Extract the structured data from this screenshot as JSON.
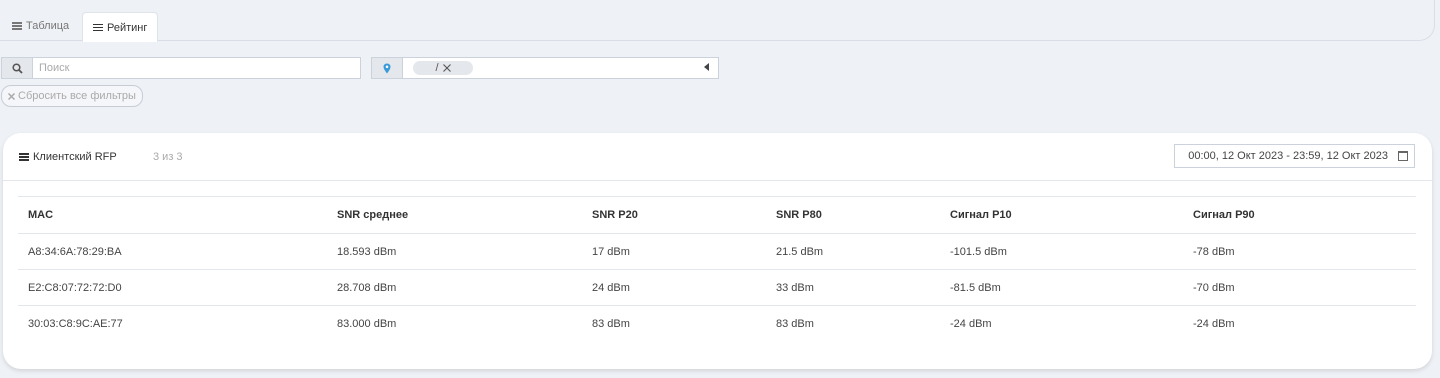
{
  "tabs": [
    {
      "label": "Таблица",
      "active": false
    },
    {
      "label": "Рейтинг",
      "active": true
    }
  ],
  "filters": {
    "search_placeholder": "Поиск",
    "location_chip": "/",
    "reset_label": "Сбросить все фильтры"
  },
  "card": {
    "title": "Клиентский RFP",
    "count": "3 из 3",
    "date_range": "00:00, 12 Окт 2023 - 23:59, 12 Окт 2023"
  },
  "table": {
    "headers": [
      "MAC",
      "SNR среднее",
      "SNR P20",
      "SNR P80",
      "Сигнал P10",
      "Сигнал P90"
    ],
    "rows": [
      [
        "A8:34:6A:78:29:BA",
        "18.593 dBm",
        "17 dBm",
        "21.5 dBm",
        "-101.5 dBm",
        "-78 dBm"
      ],
      [
        "E2:C8:07:72:72:D0",
        "28.708 dBm",
        "24 dBm",
        "33 dBm",
        "-81.5 dBm",
        "-70 dBm"
      ],
      [
        "30:03:C8:9C:AE:77",
        "83.000 dBm",
        "83 dBm",
        "83 dBm",
        "-24 dBm",
        "-24 dBm"
      ]
    ]
  },
  "colors": {
    "background": "#eef1f6",
    "accent": "#3a9ad9"
  }
}
